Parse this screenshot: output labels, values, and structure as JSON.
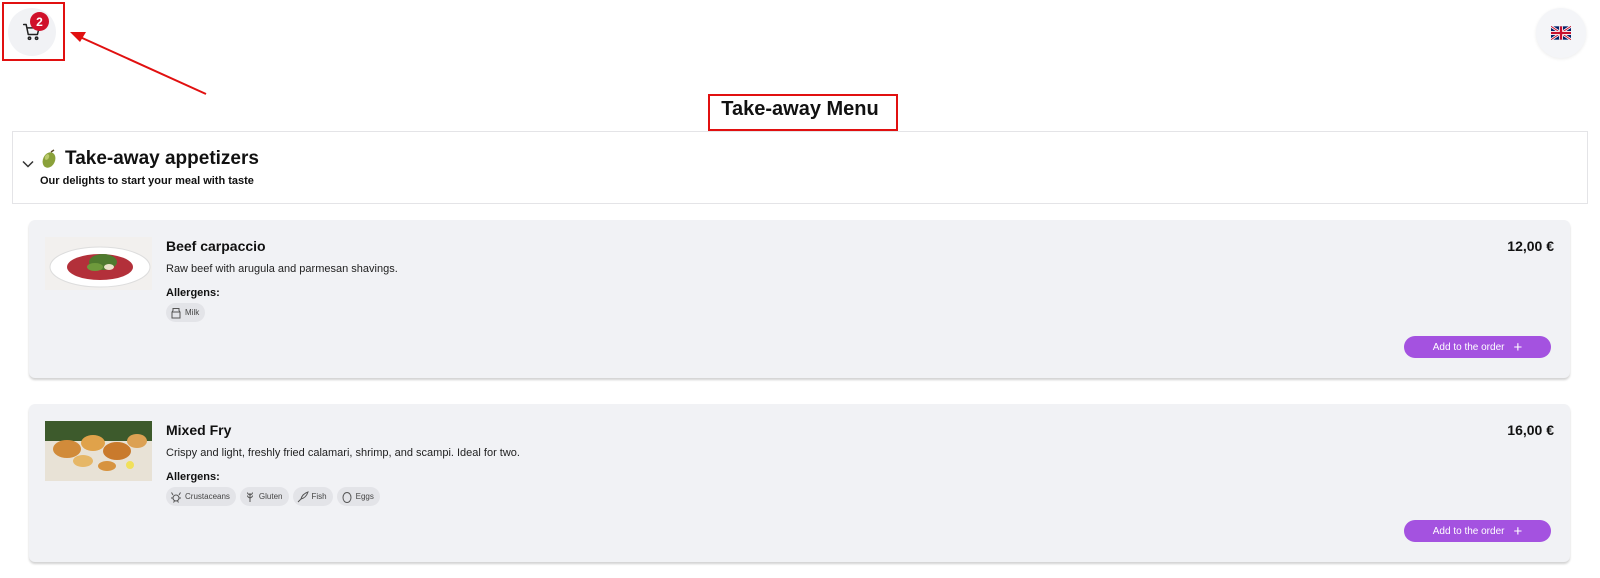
{
  "cart": {
    "count": "2"
  },
  "language": {
    "icon": "uk-flag-icon"
  },
  "page": {
    "title": "Take-away Menu"
  },
  "section": {
    "icon": "olive-icon",
    "title": "Take-away appetizers",
    "subtitle": "Our delights to start your meal with taste"
  },
  "items": [
    {
      "name": "Beef carpaccio",
      "price": "12,00 €",
      "description": "Raw beef with arugula and parmesan shavings.",
      "allergens_label": "Allergens:",
      "allergens": [
        "Milk"
      ],
      "add_label": "Add to the order"
    },
    {
      "name": "Mixed Fry",
      "price": "16,00 €",
      "description": "Crispy and light, freshly fried calamari, shrimp, and scampi. Ideal for two.",
      "allergens_label": "Allergens:",
      "allergens": [
        "Crustaceans",
        "Gluten",
        "Fish",
        "Eggs"
      ],
      "add_label": "Add to the order"
    }
  ],
  "colors": {
    "accent": "#a452e0",
    "badge": "#d0102a",
    "highlight": "#e11010"
  }
}
